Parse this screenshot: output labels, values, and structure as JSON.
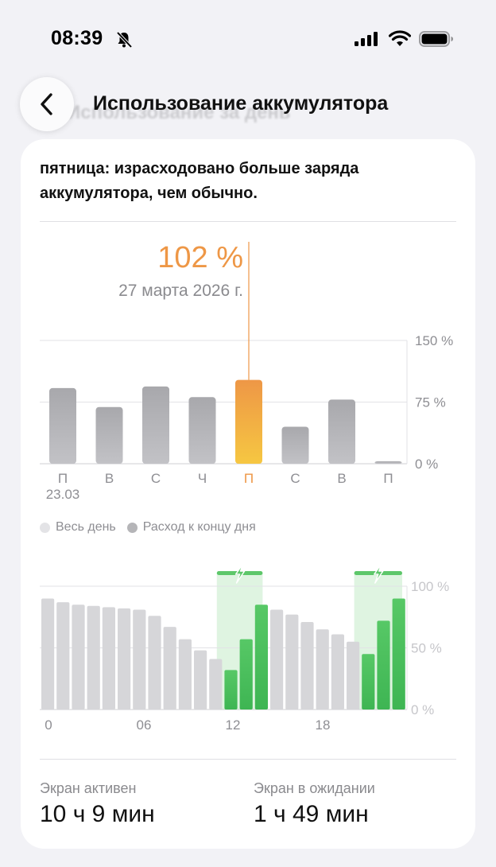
{
  "status_bar": {
    "time": "08:39"
  },
  "header": {
    "title": "Использование аккумулятора",
    "ghost_text": "Использование за день"
  },
  "notice": {
    "text": "пятница: израсходовано больше заряда аккумулятора, чем обычно."
  },
  "selected": {
    "value": "102 %",
    "date": "27 марта 2026 г."
  },
  "weekly_chart": {
    "type": "bar",
    "categories": [
      "П",
      "В",
      "С",
      "Ч",
      "П",
      "С",
      "В",
      "П"
    ],
    "first_date_label": "23.03",
    "values": [
      92,
      69,
      94,
      81,
      102,
      45,
      78,
      3
    ],
    "selected_index": 4,
    "y_ticks": [
      "150 %",
      "75 %",
      "0 %"
    ],
    "ylim": [
      0,
      150
    ]
  },
  "legend": [
    {
      "label": "Весь день",
      "color": "#e3e3e6"
    },
    {
      "label": "Расход к концу дня",
      "color": "#b5b5b8"
    }
  ],
  "hourly_chart": {
    "type": "bar",
    "x_ticks": [
      "0",
      "06",
      "12",
      "18"
    ],
    "y_ticks": [
      "100 %",
      "50 %",
      "0 %"
    ],
    "ylim": [
      0,
      100
    ],
    "values": [
      90,
      87,
      85,
      84,
      83,
      82,
      81,
      76,
      67,
      57,
      48,
      41,
      32,
      57,
      85,
      81,
      77,
      71,
      65,
      61,
      55,
      45,
      72,
      90
    ],
    "charging_hours": [
      12,
      13,
      14,
      21,
      22,
      23
    ],
    "charging_periods": [
      [
        11.5,
        14.5
      ],
      [
        20.5,
        24
      ]
    ],
    "colors": {
      "normal": "#d6d6d9",
      "charging": "#4cc25e",
      "charging_band": "#d9f2dc",
      "charging_cap": "#5dc76a"
    }
  },
  "stats": [
    {
      "label": "Экран активен",
      "value": "10 ч 9 мин"
    },
    {
      "label": "Экран в ожидании",
      "value": "1 ч 49 мин"
    }
  ],
  "colors": {
    "accent": "#ee9746",
    "background": "#f2f2f6"
  }
}
